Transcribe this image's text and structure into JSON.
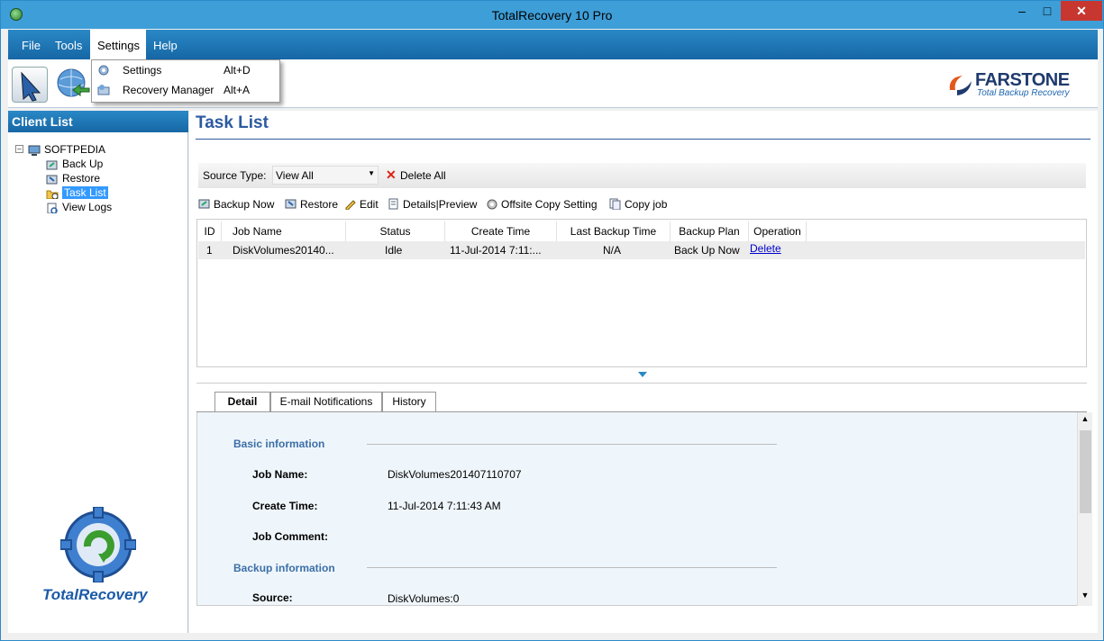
{
  "window": {
    "title": "TotalRecovery 10 Pro"
  },
  "menu": {
    "items": [
      "File",
      "Tools",
      "Settings",
      "Help"
    ]
  },
  "dropdown": {
    "items": [
      {
        "label": "Settings",
        "shortcut": "Alt+D"
      },
      {
        "label": "Recovery Manager",
        "shortcut": "Alt+A"
      }
    ]
  },
  "brand": {
    "name": "FarStone",
    "tagline": "Total Backup Recovery"
  },
  "sidebar": {
    "title": "Client List",
    "root": "SOFTPEDIA",
    "items": [
      "Back Up",
      "Restore",
      "Task List",
      "View Logs"
    ],
    "selected": "Task List",
    "product": "TotalRecovery"
  },
  "main": {
    "title": "Task List",
    "source_type_label": "Source Type:",
    "source_type_value": "View All",
    "delete_all": "Delete All",
    "actions": [
      "Backup Now",
      "Restore",
      "Edit",
      "Details|Preview",
      "Offsite Copy Setting",
      "Copy job"
    ],
    "columns": [
      "ID",
      "Job Name",
      "Status",
      "Create Time",
      "Last Backup Time",
      "Backup Plan",
      "Operation"
    ],
    "rows": [
      {
        "id": "1",
        "job_name": "DiskVolumes20140...",
        "status": "Idle",
        "create_time": "11-Jul-2014 7:11:...",
        "last_backup": "N/A",
        "plan": "Back Up Now",
        "operation": "Delete"
      }
    ]
  },
  "tabs": [
    "Detail",
    "E-mail Notifications",
    "History"
  ],
  "detail": {
    "basic_title": "Basic information",
    "job_name_label": "Job Name:",
    "job_name_value": "DiskVolumes201407110707",
    "create_time_label": "Create Time:",
    "create_time_value": "11-Jul-2014 7:11:43 AM",
    "job_comment_label": "Job Comment:",
    "backup_title": "Backup information",
    "source_label": "Source:",
    "source_value": "DiskVolumes:0"
  },
  "colors": {
    "accent": "#1f77b9",
    "title_blue": "#2c5aa0",
    "selected": "#3399ff",
    "link": "#0000cc",
    "delete_red": "#d21111"
  }
}
